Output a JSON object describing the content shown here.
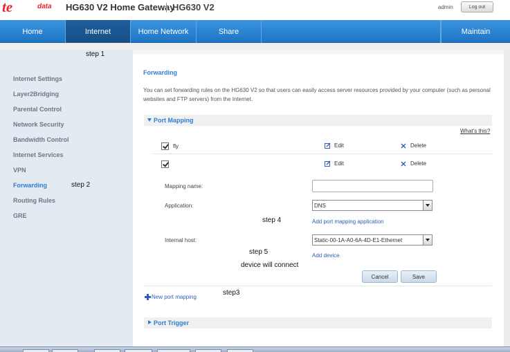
{
  "header": {
    "logo_main": "te",
    "logo_sub": "data",
    "title": "HG630 V2 Home Gateway",
    "model": "HG630 V2",
    "user": "admin",
    "logout_label": "Log out"
  },
  "nav": {
    "items": [
      {
        "label": "Home"
      },
      {
        "label": "Internet"
      },
      {
        "label": "Home Network"
      },
      {
        "label": "Share"
      },
      {
        "label": "Maintain"
      }
    ]
  },
  "sidebar": {
    "items": [
      {
        "label": "Internet Settings"
      },
      {
        "label": "Layer2Bridging"
      },
      {
        "label": "Parental Control"
      },
      {
        "label": "Network Security"
      },
      {
        "label": "Bandwidth Control"
      },
      {
        "label": "Internet Services"
      },
      {
        "label": "VPN"
      },
      {
        "label": "Forwarding"
      },
      {
        "label": "Routing Rules"
      },
      {
        "label": "GRE"
      }
    ]
  },
  "main": {
    "title": "Forwarding",
    "description": "You can set forwarding rules on the HG630 V2 so that users can easily access server resources provided by your computer (such as personal websites and FTP servers) from the Internet.",
    "port_mapping": {
      "label": "Port Mapping",
      "whats_this": "What's this?",
      "rows": [
        {
          "name": "fly",
          "edit": "Edit",
          "delete": "Delete"
        },
        {
          "name": "",
          "edit": "Edit",
          "delete": "Delete"
        }
      ],
      "form": {
        "mapping_name_label": "Mapping name:",
        "mapping_name_value": "",
        "application_label": "Application:",
        "application_value": "DNS",
        "add_application_link": "Add port mapping application",
        "internal_host_label": "Internal host:",
        "internal_host_value": "Static-00-1A-A0-6A-4D-E1-Ethernet",
        "add_device_link": "Add device",
        "cancel_label": "Cancel",
        "save_label": "Save"
      },
      "new_mapping_link": "New port mapping"
    },
    "port_trigger": {
      "label": "Port Trigger"
    }
  },
  "annotations": {
    "step1": "step 1",
    "step2": "step 2",
    "step3": "step3",
    "step4": "step 4",
    "step5": "step 5",
    "device_note": "device will connect"
  },
  "colors": {
    "nav_blue": "#2a86d6",
    "nav_active": "#1a5a96",
    "link_blue": "#2f7fd1",
    "logo_red": "#e8232a"
  }
}
